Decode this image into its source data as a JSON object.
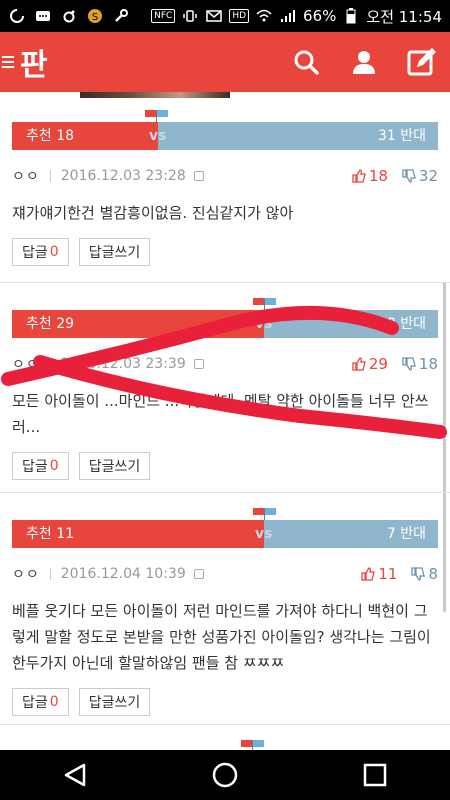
{
  "status_bar": {
    "battery": "66%",
    "time": "오전 11:54",
    "nfc": "NFC",
    "hd": "HD"
  },
  "app": {
    "logo": "판"
  },
  "comments": [
    {
      "recommend_label": "추천 18",
      "oppose_label": "31 반대",
      "recommend_ratio": 0.37,
      "author": "ㅇㅇ",
      "date": "2016.12.03 23:28",
      "likes": "18",
      "dislikes": "32",
      "text": "쟤가얘기한건 별감흥이없음. 진심같지가 않아",
      "reply_label": "답글",
      "reply_count": "0",
      "write_reply_label": "답글쓰기"
    },
    {
      "recommend_label": "추천 29",
      "oppose_label": "18 반대",
      "recommend_ratio": 0.62,
      "author": "ㅇㅇ",
      "date": "2016.12.03 23:39",
      "likes": "29",
      "dislikes": "18",
      "text": "모든 아이돌이 ...마인드 ...야할테데, 멘탈 약한 아이돌들 너무 안쓰러...",
      "reply_label": "답글",
      "reply_count": "0",
      "write_reply_label": "답글쓰기"
    },
    {
      "recommend_label": "추천 11",
      "oppose_label": "7 반대",
      "recommend_ratio": 0.59,
      "author": "ㅇㅇ",
      "date": "2016.12.04 10:39",
      "likes": "11",
      "dislikes": "8",
      "text": "베플 웃기다 모든 아이돌이 저런 마인드를 가져야 하다니 백현이 그렇게 말할 정도로 본받을 만한 성품가진 아이돌임? 생각나는 그림이 한두가지 아닌데 할말하않임 팬들 참 ㅉㅉㅉ",
      "reply_label": "답글",
      "reply_count": "0",
      "write_reply_label": "답글쓰기"
    }
  ],
  "vs_label": "vs",
  "colors": {
    "brand_red": "#e8463d",
    "oppose_blue": "#8fb6cc",
    "annotation_red": "#e8203a"
  },
  "icons": [
    "menu-icon",
    "search-icon",
    "user-icon",
    "write-icon",
    "thumb-up-icon",
    "thumb-down-icon",
    "back-icon",
    "home-icon",
    "recents-icon"
  ]
}
